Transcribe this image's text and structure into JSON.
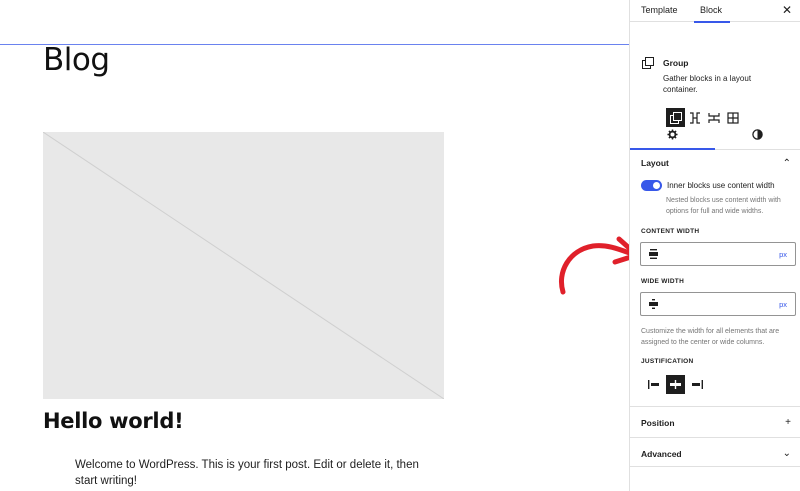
{
  "canvas": {
    "page_title": "Blog",
    "post_title": "Hello world!",
    "post_excerpt": "Welcome to WordPress. This is your first post. Edit or delete it, then start writing!"
  },
  "sidebar": {
    "tabs": [
      {
        "label": "Template",
        "active": false
      },
      {
        "label": "Block",
        "active": true
      }
    ],
    "close_icon": "close-icon",
    "close_glyph": "✕",
    "block": {
      "icon": "group-icon",
      "name": "Group",
      "description": "Gather blocks in a layout container."
    },
    "variations": [
      {
        "icon": "group-icon",
        "active": true
      },
      {
        "icon": "row-icon",
        "active": false
      },
      {
        "icon": "stack-icon",
        "active": false
      },
      {
        "icon": "grid-icon",
        "active": false
      }
    ],
    "settings_tabs": [
      {
        "icon": "gear-icon",
        "active": true
      },
      {
        "icon": "styles-icon",
        "active": false
      }
    ],
    "layout": {
      "title": "Layout",
      "expanded": true,
      "chevron": "⌃",
      "toggle_label": "Inner blocks use content width",
      "toggle_on": true,
      "toggle_help": "Nested blocks use content width with options for full and wide widths.",
      "content_width_label": "CONTENT WIDTH",
      "content_width_value": "",
      "content_width_unit": "px",
      "wide_width_label": "WIDE WIDTH",
      "wide_width_value": "",
      "wide_width_unit": "px",
      "width_help": "Customize the width for all elements that are assigned to the center or wide columns.",
      "justification_label": "JUSTIFICATION",
      "justification_options": [
        {
          "icon": "justify-left-icon",
          "active": false
        },
        {
          "icon": "justify-center-icon",
          "active": true
        },
        {
          "icon": "justify-right-icon",
          "active": false
        }
      ]
    },
    "position": {
      "title": "Position",
      "expanded": false,
      "toggle_glyph": "+"
    },
    "advanced": {
      "title": "Advanced",
      "expanded": false,
      "toggle_glyph": "⌄"
    }
  },
  "colors": {
    "accent": "#3858e9",
    "annotation_arrow": "#e0202a",
    "placeholder_bg": "#e8e8e8"
  }
}
